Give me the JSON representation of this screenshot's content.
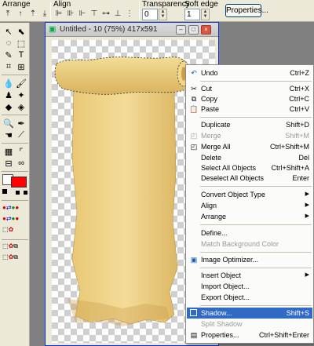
{
  "toolbar": {
    "arrange_label": "Arrange",
    "align_label": "Align",
    "transparency_label": "Transparency",
    "transparency_value": "0",
    "soft_edge_label": "Soft edge",
    "soft_edge_value": "1",
    "properties_button": "Properties..."
  },
  "document": {
    "title": "Untitled - 10 (75%) 417x591"
  },
  "menu": {
    "undo": {
      "label": "Undo",
      "shortcut": "Ctrl+Z"
    },
    "cut": {
      "label": "Cut",
      "shortcut": "Ctrl+X"
    },
    "copy": {
      "label": "Copy",
      "shortcut": "Ctrl+C"
    },
    "paste": {
      "label": "Paste",
      "shortcut": "Ctrl+V"
    },
    "duplicate": {
      "label": "Duplicate",
      "shortcut": "Shift+D"
    },
    "merge": {
      "label": "Merge",
      "shortcut": "Shift+M"
    },
    "merge_all": {
      "label": "Merge All",
      "shortcut": "Ctrl+Shift+M"
    },
    "delete": {
      "label": "Delete",
      "shortcut": "Del"
    },
    "select_all": {
      "label": "Select All Objects",
      "shortcut": "Ctrl+Shift+A"
    },
    "deselect_all": {
      "label": "Deselect All Objects",
      "shortcut": "Enter"
    },
    "convert_type": {
      "label": "Convert Object Type"
    },
    "align": {
      "label": "Align"
    },
    "arrange": {
      "label": "Arrange"
    },
    "define": {
      "label": "Define..."
    },
    "match_bg": {
      "label": "Match Background Color"
    },
    "image_optimizer": {
      "label": "Image Optimizer..."
    },
    "insert_object": {
      "label": "Insert Object"
    },
    "import_object": {
      "label": "Import Object..."
    },
    "export_object": {
      "label": "Export Object..."
    },
    "shadow": {
      "label": "Shadow...",
      "shortcut": "Shift+S"
    },
    "split_shadow": {
      "label": "Split Shadow"
    },
    "properties": {
      "label": "Properties...",
      "shortcut": "Ctrl+Shift+Enter"
    }
  },
  "colors": {
    "highlight": "#316ac5",
    "scroll_fill_light": "#f3dc93",
    "scroll_fill_dark": "#d7b463",
    "foreground_swatch": "#ff0000"
  }
}
